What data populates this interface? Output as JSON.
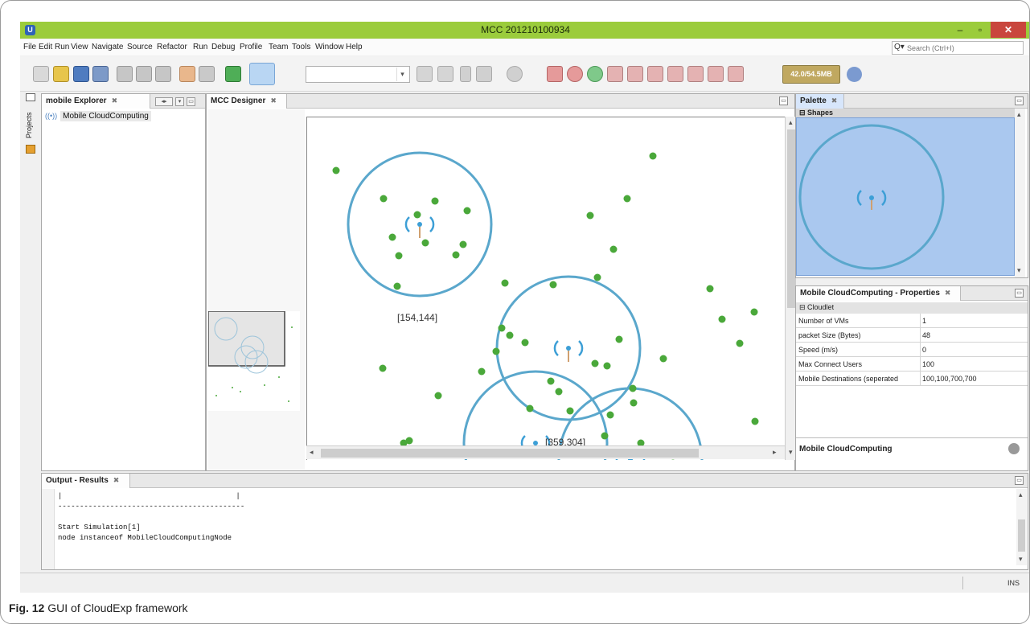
{
  "window": {
    "logo": "U",
    "title": "MCC 201210100934",
    "min_label": "–",
    "max_label": "▫",
    "close_label": "✕"
  },
  "menu": [
    "File",
    "Edit",
    "Run",
    "View",
    "Navigate",
    "Source",
    "Refactor",
    "Run",
    "Debug",
    "Profile",
    "Team",
    "Tools",
    "Window",
    "Help"
  ],
  "search": {
    "icon": "Q▾",
    "placeholder": "Search (Ctrl+I)"
  },
  "toolbar": {
    "memory_label": "42.0/54.5MB",
    "icons": [
      "new-project-icon",
      "new-file-icon",
      "open-project-icon",
      "save-all-icon",
      "cut-icon",
      "copy-icon",
      "paste-icon",
      "undo-icon",
      "redo-icon",
      "excel-icon",
      "run-arrow-icon",
      "hammer-icon",
      "clean-build-icon",
      "run-icon",
      "debug-icon",
      "profile-icon",
      "stop-icon",
      "record-icon",
      "green-record-icon",
      "tool-a-icon",
      "tool-b-icon",
      "tool-c-icon",
      "tool-d-icon",
      "tool-e-icon",
      "tool-f-icon",
      "tool-g-icon",
      "gc-icon"
    ]
  },
  "side": {
    "projects_label": "Projects"
  },
  "explorer": {
    "tab_label": "mobile Explorer",
    "tree_icon": "((•))",
    "tree_root": "Mobile CloudComputing"
  },
  "designer": {
    "tab_label": "MCC Designer",
    "circle_labels": [
      "[154,144]",
      "[359,304]"
    ]
  },
  "palette": {
    "tab_label": "Palette",
    "section": "Shapes"
  },
  "properties": {
    "tab_label": "Mobile CloudComputing - Properties",
    "group": "Cloudlet",
    "rows": [
      {
        "name": "Number of VMs",
        "value": "1"
      },
      {
        "name": "packet Size (Bytes)",
        "value": "48"
      },
      {
        "name": "Speed (m/s)",
        "value": "0"
      },
      {
        "name": "Max Connect Users",
        "value": "100"
      },
      {
        "name": "Mobile Destinations (seperated",
        "value": "100,100,700,700"
      }
    ],
    "footer_title": "Mobile CloudComputing"
  },
  "output": {
    "tab_label": "Output - Results",
    "lines": [
      "|                                        |",
      "-------------------------------------------",
      "",
      "Start Simulation[1]",
      "node instanceof MobileCloudComputingNode"
    ]
  },
  "status": {
    "mode": "INS"
  },
  "caption": {
    "label": "Fig. 12",
    "text": "GUI of CloudExp framework"
  },
  "colors": {
    "titlebar": "#9bcc3c",
    "node": "#4aa83a",
    "range_circle": "#5aa7cc",
    "palette_bg": "#aac8ef",
    "close": "#c9463d"
  }
}
